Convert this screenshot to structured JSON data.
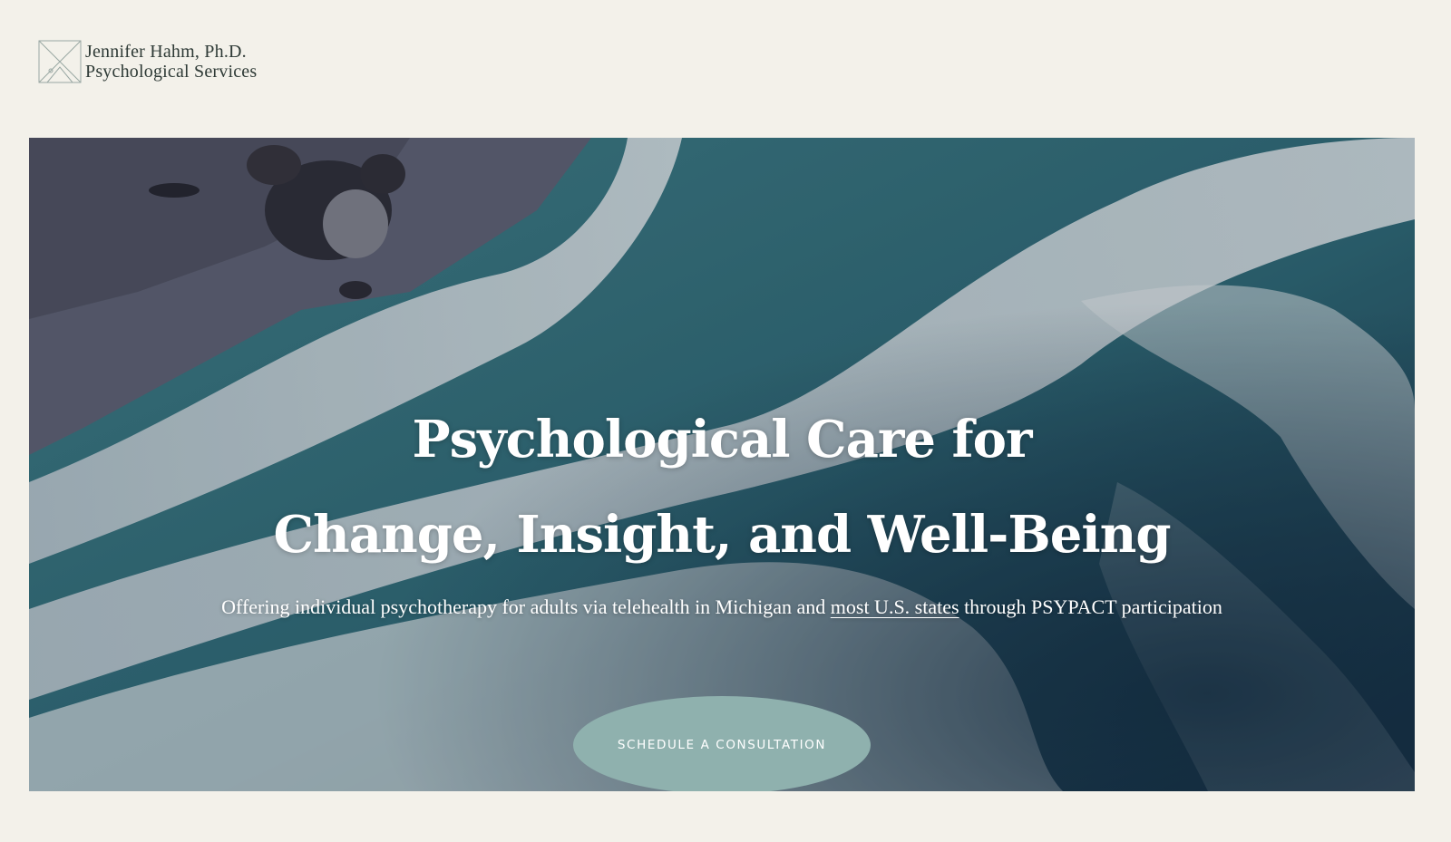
{
  "site": {
    "name_line_1": "Jennifer Hahm, Ph.D.",
    "name_line_2": "Psychological Services",
    "logo_icon": "envelope-monogram-icon"
  },
  "hero": {
    "title_line_1": "Psychological Care for",
    "title_line_2": "Change, Insight, and Well-Being",
    "subtitle_before_link": "Offering individual psychotherapy for adults via telehealth in Michigan and ",
    "subtitle_link": "most U.S. states",
    "subtitle_after_link": " through PSYPACT participation",
    "cta_label": "SCHEDULE A CONSULTATION",
    "background": "aerial ocean waves"
  },
  "colors": {
    "page_background": "#f3f1ea",
    "cta_background": "#8fb1ae",
    "text_dark": "#2e3a36",
    "ocean_deep": "#1d4a55",
    "foam": "#e9ece9"
  }
}
